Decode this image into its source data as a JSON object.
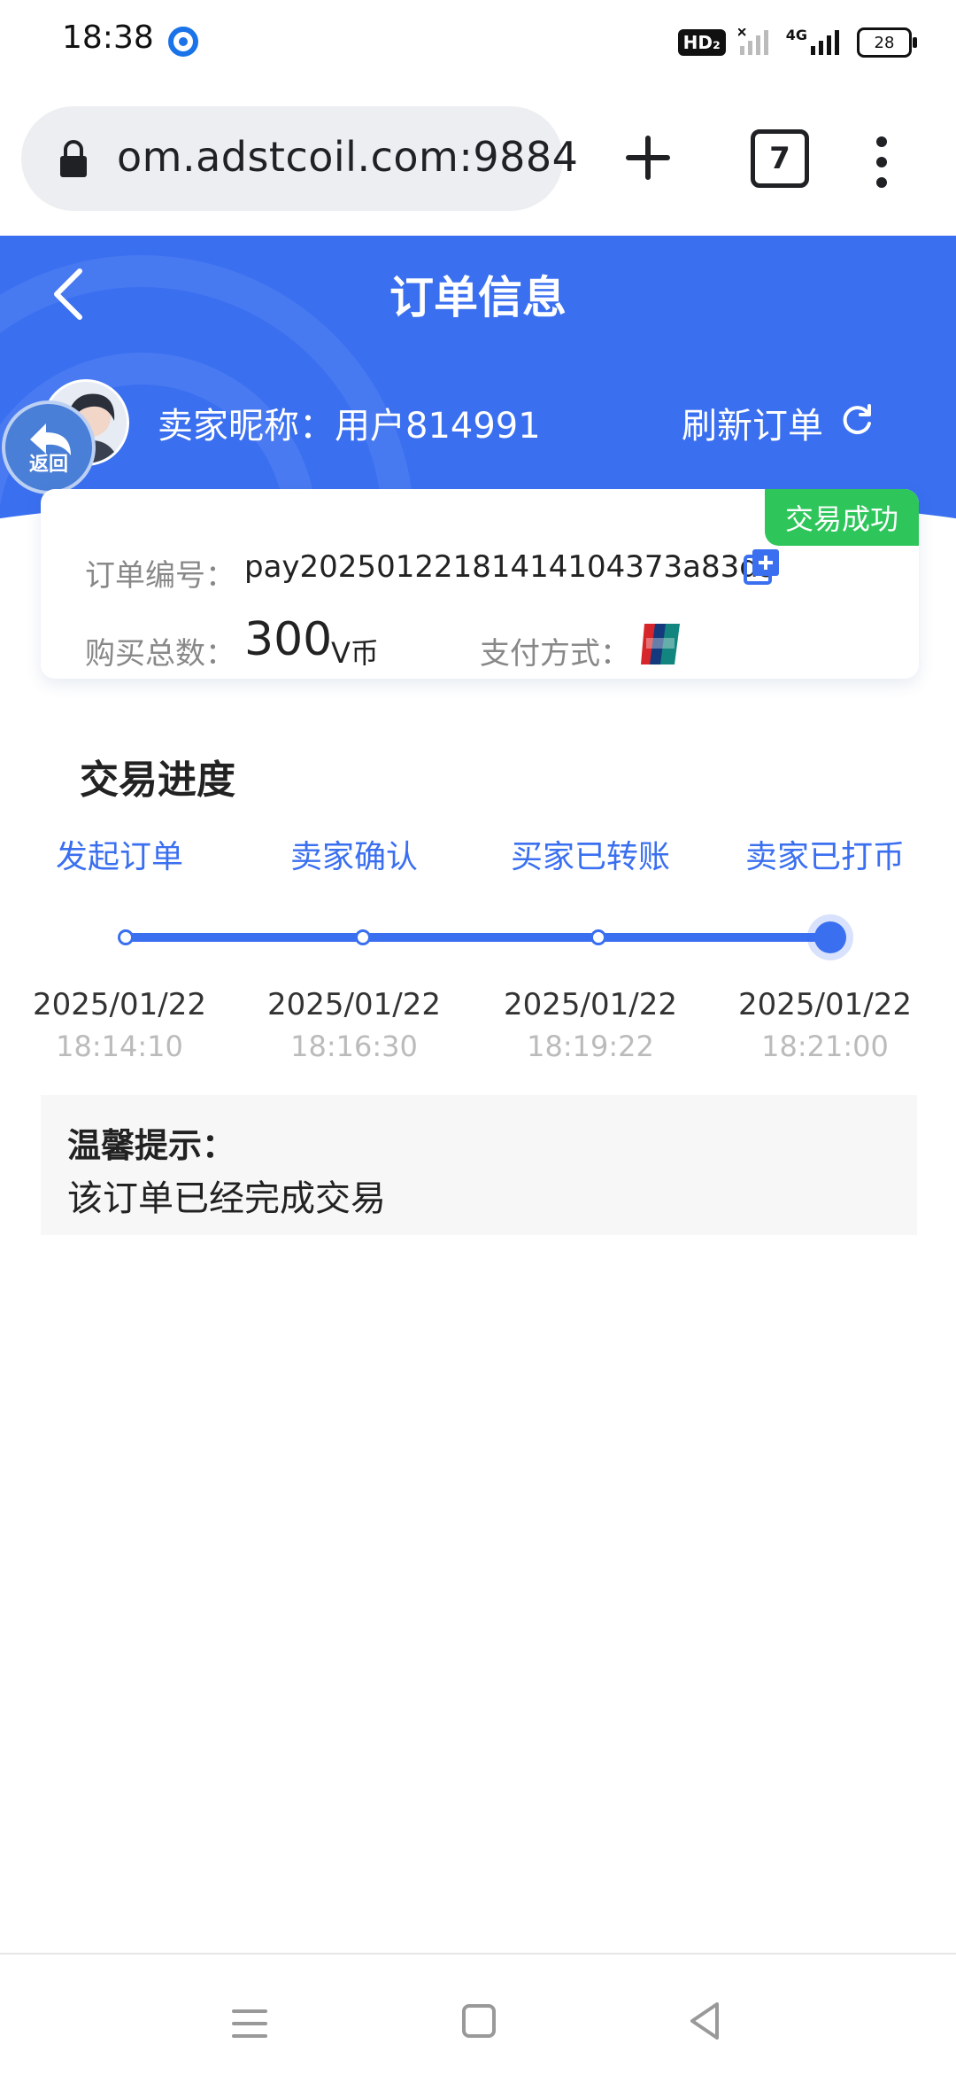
{
  "status_bar": {
    "time": "18:38",
    "hd": "HD₂",
    "network": "4G",
    "battery": "28"
  },
  "browser": {
    "url": "om.adstcoil.com:9884",
    "tab_count": "7"
  },
  "header": {
    "title": "订单信息",
    "return_label": "返回",
    "seller_label": "卖家昵称：用户814991",
    "refresh_label": "刷新订单"
  },
  "order": {
    "status_badge": "交易成功",
    "order_no_label": "订单编号：",
    "order_no": "pay20250122181414104373a83d9",
    "qty_label": "购买总数：",
    "qty_value": "300",
    "qty_unit": "V币",
    "pay_label": "支付方式：",
    "pay_method_icon": "unionpay-icon"
  },
  "progress": {
    "title": "交易进度",
    "completed_step": 4,
    "steps": [
      {
        "label": "发起订单",
        "date": "2025/01/22",
        "time": "18:14:10"
      },
      {
        "label": "卖家确认",
        "date": "2025/01/22",
        "time": "18:16:30"
      },
      {
        "label": "买家已转账",
        "date": "2025/01/22",
        "time": "18:19:22"
      },
      {
        "label": "卖家已打币",
        "date": "2025/01/22",
        "time": "18:21:00"
      }
    ]
  },
  "tip": {
    "title": "温馨提示：",
    "text": "该订单已经完成交易"
  },
  "colors": {
    "primary": "#3a6ff0",
    "success": "#2ec65a"
  }
}
